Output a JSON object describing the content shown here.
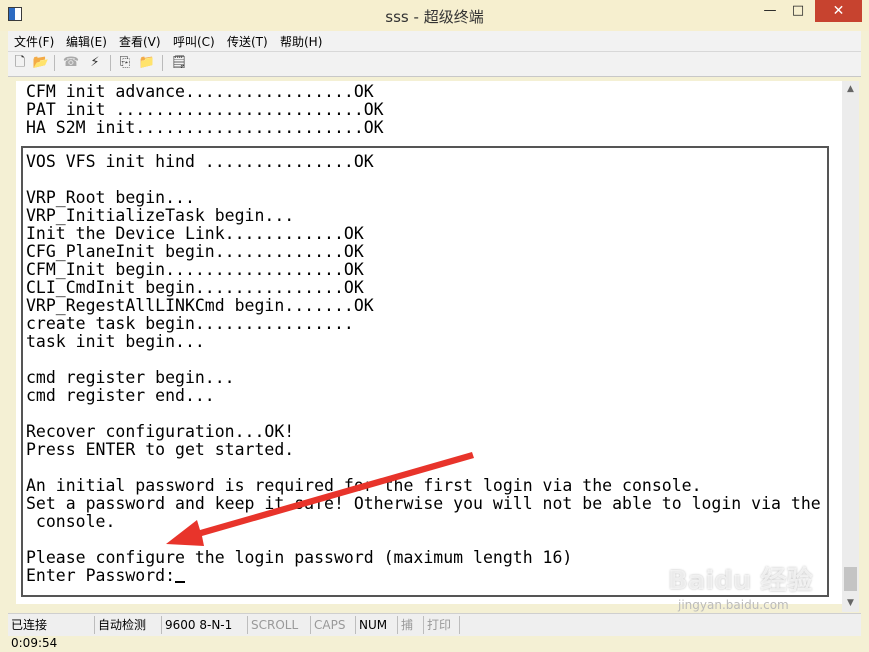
{
  "window": {
    "title": "sss - 超级终端",
    "minimize_label": "—",
    "maximize_label": "□",
    "close_label": "✕"
  },
  "menu": {
    "items": [
      "文件(F)",
      "编辑(E)",
      "查看(V)",
      "呼叫(C)",
      "传送(T)",
      "帮助(H)"
    ]
  },
  "toolbar": {
    "icons": [
      "new-document-icon",
      "open-folder-icon",
      "phone-icon",
      "disconnect-icon",
      "send-icon",
      "receive-icon",
      "properties-icon"
    ]
  },
  "terminal": {
    "top_lines": [
      "CFM init advance.................OK",
      "PAT init .........................OK",
      "HA S2M init.......................OK"
    ],
    "main_lines": [
      "VOS VFS init hind ...............OK",
      "",
      "VRP_Root begin...",
      "VRP_InitializeTask begin...",
      "Init the Device Link............OK",
      "CFG_PlaneInit begin.............OK",
      "CFM_Init begin..................OK",
      "CLI_CmdInit begin...............OK",
      "VRP_RegestAllLINKCmd begin.......OK",
      "create task begin................",
      "task init begin...",
      "",
      "cmd register begin...",
      "cmd register end...",
      "",
      "Recover configuration...OK!",
      "Press ENTER to get started.",
      "",
      "An initial password is required for the first login via the console.",
      "Set a password and keep it safe! Otherwise you will not be able to login via the",
      " console.",
      "",
      "Please configure the login password (maximum length 16)",
      "Enter Password:"
    ]
  },
  "status": {
    "connected": "已连接 0:09:54",
    "detect": "自动检测",
    "port": "9600 8-N-1",
    "scroll": "SCROLL",
    "caps": "CAPS",
    "num": "NUM",
    "capture": "捕",
    "print": "打印"
  },
  "watermark": {
    "brand": "Baidu 经验",
    "url": "jingyan.baidu.com"
  },
  "colors": {
    "close_button": "#c7432f",
    "annotation_arrow": "#e8342b"
  }
}
